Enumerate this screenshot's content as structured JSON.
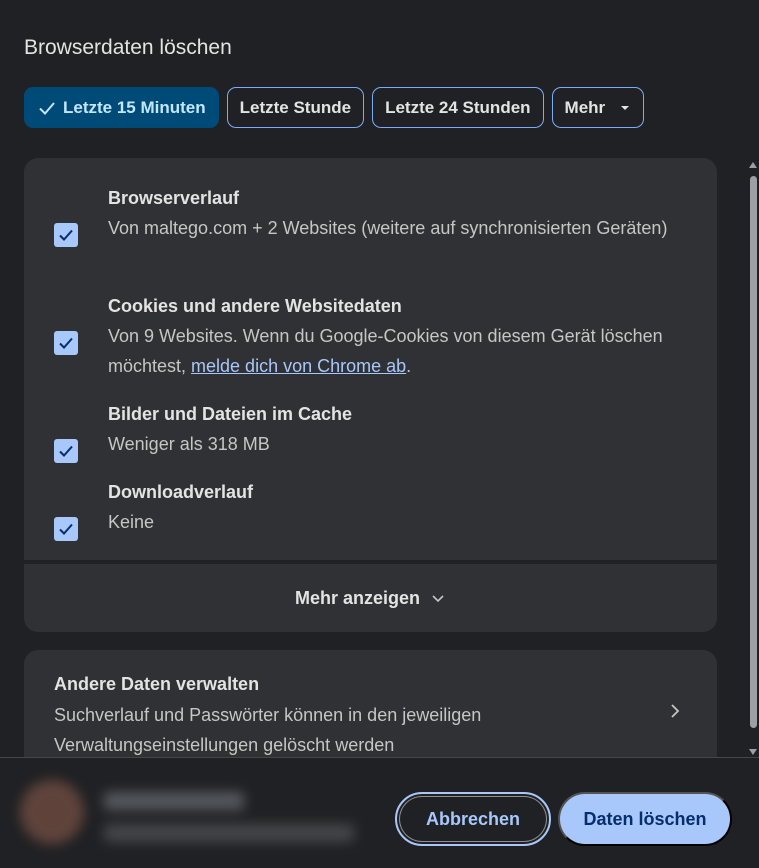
{
  "dialog": {
    "title": "Browserdaten löschen"
  },
  "time_chips": [
    {
      "label": "Letzte 15 Minuten",
      "selected": true
    },
    {
      "label": "Letzte Stunde",
      "selected": false
    },
    {
      "label": "Letzte 24 Stunden",
      "selected": false
    },
    {
      "label": "Mehr",
      "selected": false
    }
  ],
  "items": {
    "history": {
      "title": "Browserverlauf",
      "desc": "Von maltego.com + 2 Websites (weitere auf synchronisierten Geräten)",
      "checked": true
    },
    "cookies": {
      "title": "Cookies und andere Websitedaten",
      "desc_before": "Von 9 Websites. Wenn du Google-Cookies von diesem Gerät löschen möchtest, ",
      "link": "melde dich von Chrome ab",
      "desc_after": ".",
      "checked": true
    },
    "cache": {
      "title": "Bilder und Dateien im Cache",
      "desc": "Weniger als 318 MB",
      "checked": true
    },
    "downloads": {
      "title": "Downloadverlauf",
      "desc": "Keine",
      "checked": true
    }
  },
  "more": {
    "label": "Mehr anzeigen"
  },
  "other_data": {
    "title": "Andere Daten verwalten",
    "desc": "Suchverlauf und Passwörter können in den jeweiligen Verwaltungseinstellungen gelöscht werden"
  },
  "footer": {
    "cancel_label": "Abbrechen",
    "clear_label": "Daten löschen"
  },
  "colors": {
    "background": "#202124",
    "card": "#303134",
    "accent": "#a8c7fa",
    "selected_chip": "#004a77"
  },
  "icons": {
    "check": "check-icon",
    "dropdown": "caret-down-icon",
    "chevron_down": "chevron-down-icon",
    "chevron_right": "chevron-right-icon"
  }
}
